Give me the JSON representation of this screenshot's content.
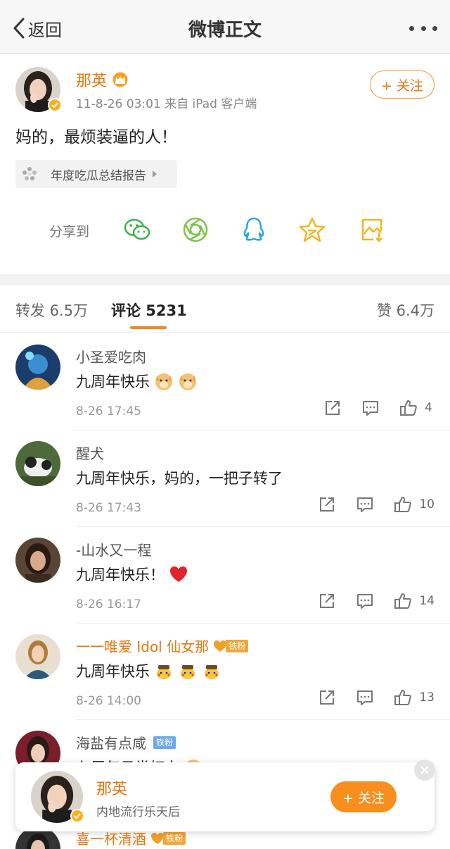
{
  "nav": {
    "back_label": "返回",
    "title": "微博正文"
  },
  "post": {
    "author": "那英",
    "meta": "11-8-26 03:01  来自 iPad 客户端",
    "follow_label": "+ 关注",
    "text": "妈的，最烦装逼的人！",
    "tag": "年度吃瓜总结报告",
    "share_label": "分享到",
    "share_icons": [
      "wechat-icon",
      "moments-icon",
      "qq-icon",
      "qzone-icon",
      "save-image-icon"
    ]
  },
  "tabs": {
    "repost": "转发 6.5万",
    "comment": "评论 5231",
    "like": "赞 6.4万"
  },
  "comments": [
    {
      "name": "小圣爱吃肉",
      "text": "九周年快乐",
      "emoji": [
        "doge-emoji",
        "doge-emoji"
      ],
      "time": "8-26 17:45",
      "likes": "4"
    },
    {
      "name": "醒犬",
      "text": "九周年快乐，妈的，一把子转了",
      "emoji": [],
      "time": "8-26 17:43",
      "likes": "10"
    },
    {
      "name": "-山水又一程",
      "text": "九周年快乐！",
      "emoji": [
        "heart-emoji"
      ],
      "time": "8-26 16:17",
      "likes": "14"
    },
    {
      "name": "一一唯爱 Idol 仙女那",
      "text": "九周年快乐",
      "emoji": [
        "pikachu-emoji",
        "pikachu-emoji",
        "pikachu-emoji"
      ],
      "time": "8-26 14:00",
      "likes": "13",
      "badge": "铁粉",
      "name_color": "orange"
    },
    {
      "name": "海盐有点咸",
      "text": "九周年日常打卡",
      "emoji": [
        "doge-emoji"
      ],
      "badge": "铁粉",
      "badge_style": "blue"
    },
    {
      "name": "喜一杯清酒",
      "badge": "铁粉"
    }
  ],
  "float_card": {
    "name": "那英",
    "desc": "内地流行乐天后",
    "follow_label": "+ 关注"
  },
  "colors": {
    "accent": "#e8760e",
    "follow_fill": "#f78e1e",
    "tab_underline": "#f08a24"
  }
}
